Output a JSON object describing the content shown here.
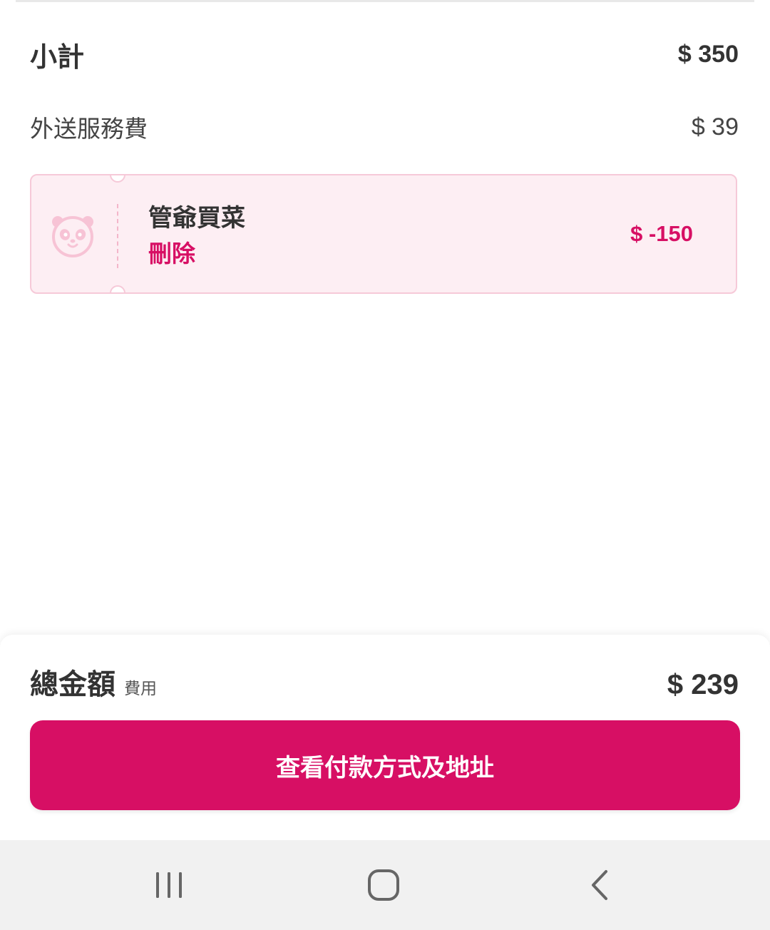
{
  "summary": {
    "subtotal_label": "小計",
    "subtotal_amount": "$ 350",
    "delivery_label": "外送服務費",
    "delivery_amount": "$ 39"
  },
  "voucher": {
    "icon": "panda-icon",
    "name": "管爺買菜",
    "remove_label": "刪除",
    "amount": "$ -150"
  },
  "total": {
    "label": "總金額",
    "sub_label": "費用",
    "amount": "$ 239"
  },
  "cta": {
    "label": "查看付款方式及地址"
  },
  "navbar": {
    "icons": [
      "recent-apps-icon",
      "home-icon",
      "back-icon"
    ]
  },
  "colors": {
    "accent": "#d70f64",
    "voucher_bg": "#fdeef3",
    "voucher_border": "#f6c9d8",
    "navbar_bg": "#f1f1f1"
  }
}
